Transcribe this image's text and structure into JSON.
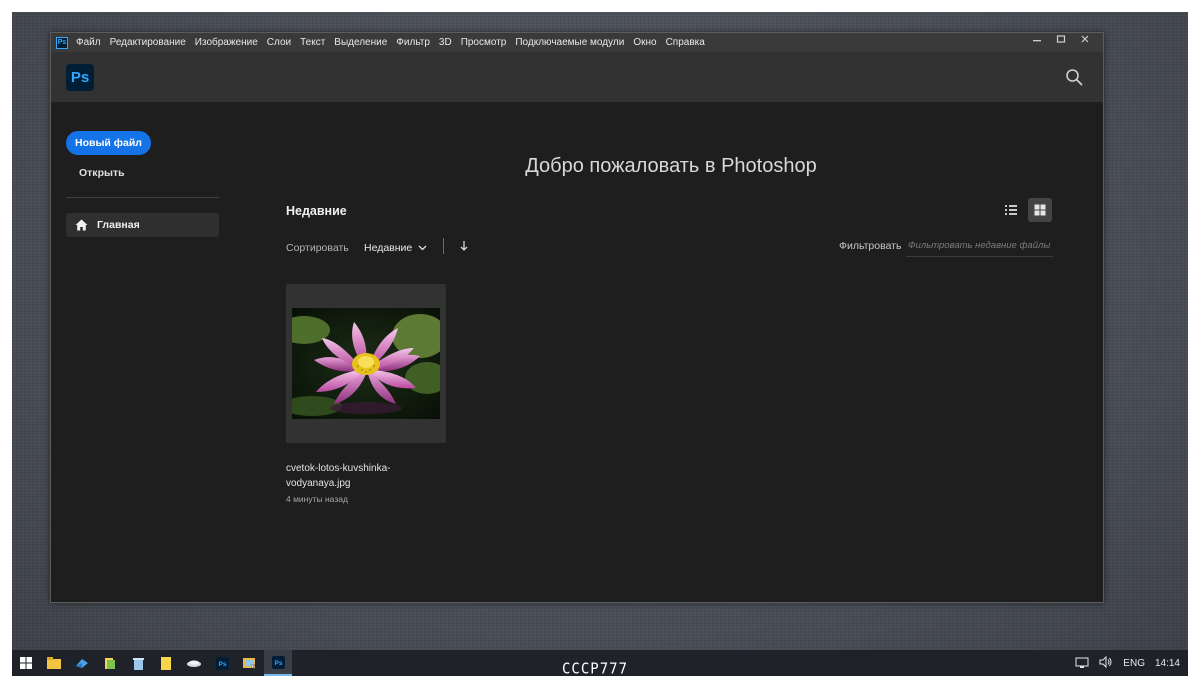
{
  "menubar": {
    "items": [
      "Файл",
      "Редактирование",
      "Изображение",
      "Слои",
      "Текст",
      "Выделение",
      "Фильтр",
      "3D",
      "Просмотр",
      "Подключаемые модули",
      "Окно",
      "Справка"
    ],
    "app_icon": "Ps",
    "window_controls": [
      "minimize-icon",
      "maximize-icon",
      "close-icon"
    ]
  },
  "header": {
    "logo": "Ps",
    "search_icon": "search-icon"
  },
  "sidebar": {
    "new_file": "Новый файл",
    "open": "Открыть",
    "nav": [
      {
        "label": "Главная",
        "icon": "home-icon"
      }
    ]
  },
  "main": {
    "welcome": "Добро пожаловать в Photoshop",
    "recent_title": "Недавние",
    "sort_label": "Сортировать",
    "sort_value": "Недавние",
    "filter_label": "Фильтровать",
    "filter_placeholder": "Фильтровать недавние файлы",
    "files": [
      {
        "name": "cvetok-lotos-kuvshinka-vodyanaya.jpg",
        "time": "4 минуты назад"
      }
    ]
  },
  "taskbar": {
    "tray_lang": "ENG",
    "clock": "14:14"
  },
  "watermark": "СССР777",
  "colors": {
    "accent": "#1473e6",
    "ps_blue": "#31a8ff",
    "ps_dark": "#001e36",
    "background": "#1e1e1e"
  }
}
